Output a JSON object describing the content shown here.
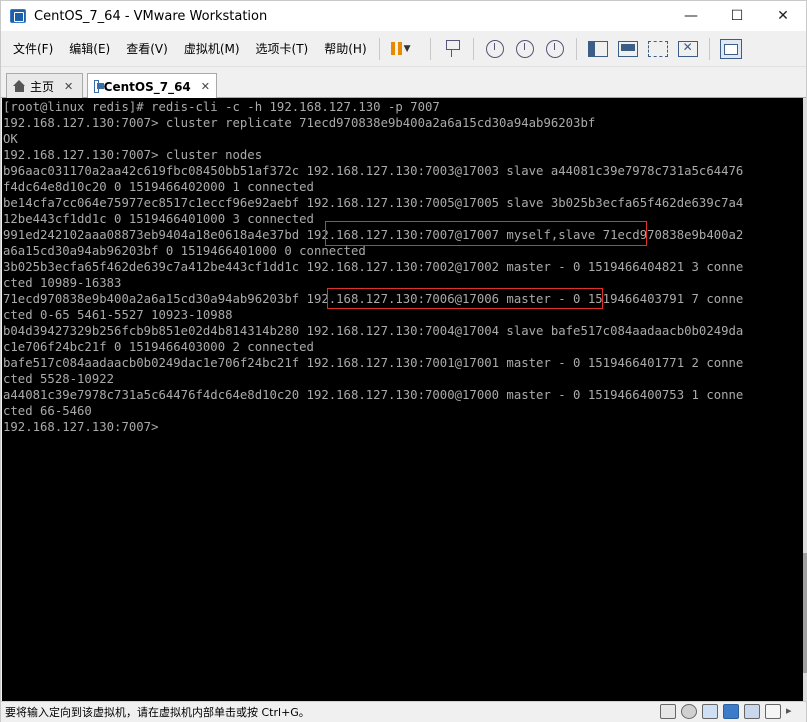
{
  "window": {
    "title": "CentOS_7_64 - VMware Workstation",
    "minimize_glyph": "—",
    "maximize_glyph": "☐",
    "close_glyph": "✕"
  },
  "menu": {
    "items": [
      "文件(F)",
      "编辑(E)",
      "查看(V)",
      "虚拟机(M)",
      "选项卡(T)",
      "帮助(H)"
    ]
  },
  "toolbar": {
    "dropdown_glyph": "▼",
    "icons": [
      "pause-icon",
      "send-ctrl-alt-del-icon",
      "snapshot-icon",
      "revert-snapshot-icon",
      "snapshot-manager-icon",
      "library-view-icon",
      "thumbnail-view-icon",
      "fullscreen-icon",
      "unity-icon",
      "console-view-icon"
    ]
  },
  "tabs": [
    {
      "label": "主页",
      "icon": "home-icon",
      "close": "✕",
      "active": false
    },
    {
      "label": "CentOS_7_64",
      "icon": "vm-icon",
      "close": "✕",
      "active": true
    }
  ],
  "console": {
    "lines": [
      "[root@linux redis]# redis-cli -c -h 192.168.127.130 -p 7007",
      "192.168.127.130:7007> cluster replicate 71ecd970838e9b400a2a6a15cd30a94ab96203bf",
      "OK",
      "192.168.127.130:7007> cluster nodes",
      "b96aac031170a2aa42c619fbc08450bb51af372c 192.168.127.130:7003@17003 slave a44081c39e7978c731a5c64476",
      "f4dc64e8d10c20 0 1519466402000 1 connected",
      "be14cfa7cc064e75977ec8517c1eccf96e92aebf 192.168.127.130:7005@17005 slave 3b025b3ecfa65f462de639c7a4",
      "12be443cf1dd1c 0 1519466401000 3 connected",
      "991ed242102aaa08873eb9404a18e0618a4e37bd 192.168.127.130:7007@17007 myself,slave 71ecd970838e9b400a2",
      "a6a15cd30a94ab96203bf 0 1519466401000 0 connected",
      "3b025b3ecfa65f462de639c7a412be443cf1dd1c 192.168.127.130:7002@17002 master - 0 1519466404821 3 conne",
      "cted 10989-16383",
      "71ecd970838e9b400a2a6a15cd30a94ab96203bf 192.168.127.130:7006@17006 master - 0 1519466403791 7 conne",
      "cted 0-65 5461-5527 10923-10988",
      "b04d39427329b256fcb9b851e02d4b814314b280 192.168.127.130:7004@17004 slave bafe517c084aadaacb0b0249da",
      "c1e706f24bc21f 0 1519466403000 2 connected",
      "bafe517c084aadaacb0b0249dac1e706f24bc21f 192.168.127.130:7001@17001 master - 0 1519466401771 2 conne",
      "cted 5528-10922",
      "a44081c39e7978c731a5c64476f4dc64e8d10c20 192.168.127.130:7000@17000 master - 0 1519466400753 1 conne",
      "cted 66-5460",
      "192.168.127.130:7007>"
    ]
  },
  "statusbar": {
    "text": "要将输入定向到该虚拟机，请在虚拟机内部单击或按 Ctrl+G。",
    "icons": [
      "hard-disk-icon",
      "cd-icon",
      "network-icon",
      "usb-icon",
      "sound-icon",
      "display-icon",
      "expand-arrow-icon"
    ]
  },
  "colors": {
    "console_bg": "#000000",
    "console_text": "#aaaaaa",
    "highlight_box": "#e0302a",
    "pause_orange": "#e68a00"
  }
}
